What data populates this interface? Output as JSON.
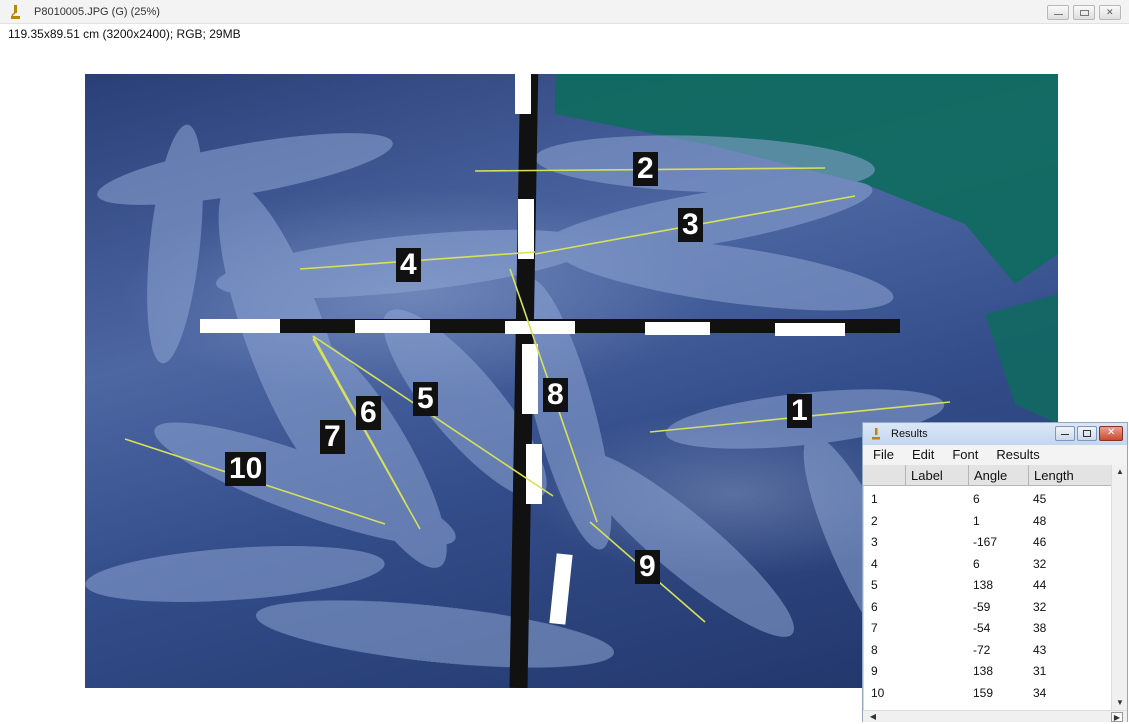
{
  "window": {
    "title": "P8010005.JPG (G) (25%)",
    "subtitle": "119.35x89.51 cm (3200x2400); RGB; 29MB",
    "app_icon": "microscope-icon",
    "controls": [
      "minimize-icon",
      "maximize-icon",
      "close-icon"
    ]
  },
  "image": {
    "description_icon": "photo",
    "line_color": "#d7e05a",
    "scale_bar": "black-and-white-striped-ruler",
    "labels": [
      {
        "text": "1"
      },
      {
        "text": "2"
      },
      {
        "text": "3"
      },
      {
        "text": "4"
      },
      {
        "text": "5"
      },
      {
        "text": "6"
      },
      {
        "text": "7"
      },
      {
        "text": "8"
      },
      {
        "text": "9"
      },
      {
        "text": "10"
      }
    ]
  },
  "results": {
    "title": "Results",
    "icon": "microscope-icon",
    "menu": [
      "File",
      "Edit",
      "Font",
      "Results"
    ],
    "columns": [
      "",
      "Label",
      "Angle",
      "Length"
    ],
    "rows": [
      {
        "n": "1",
        "label": "",
        "angle": "6",
        "length": "45"
      },
      {
        "n": "2",
        "label": "",
        "angle": "1",
        "length": "48"
      },
      {
        "n": "3",
        "label": "",
        "angle": "-167",
        "length": "46"
      },
      {
        "n": "4",
        "label": "",
        "angle": "6",
        "length": "32"
      },
      {
        "n": "5",
        "label": "",
        "angle": "138",
        "length": "44"
      },
      {
        "n": "6",
        "label": "",
        "angle": "-59",
        "length": "32"
      },
      {
        "n": "7",
        "label": "",
        "angle": "-54",
        "length": "38"
      },
      {
        "n": "8",
        "label": "",
        "angle": "-72",
        "length": "43"
      },
      {
        "n": "9",
        "label": "",
        "angle": "138",
        "length": "31"
      },
      {
        "n": "10",
        "label": "",
        "angle": "159",
        "length": "34"
      }
    ]
  },
  "colors": {
    "titlebar": "#f3f3f3",
    "results_titlebar": "#c3d6ef",
    "close_button": "#c84b30",
    "net": "#0f6b5f"
  }
}
